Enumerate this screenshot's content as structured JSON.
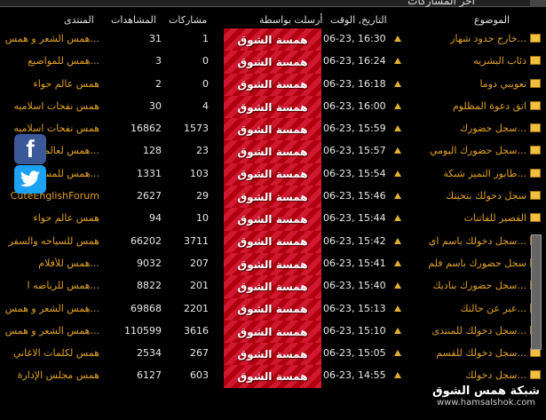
{
  "window": {
    "title": "آخر المشاركات"
  },
  "headers": {
    "topic": "الموضوع",
    "date": "التاريخ, الوقت",
    "user": "أرسلت بواسطة",
    "posts": "مشاركات",
    "views": "المشاهدات",
    "forum": "المنتدى"
  },
  "rows": [
    {
      "topic": "خارج حدود شهار...",
      "date": "06-23, 16:30",
      "user": "همسة الشوق",
      "posts": "1",
      "views": "31",
      "forum": "همس الشعر و همس..."
    },
    {
      "topic": "ذئاب البشريه",
      "date": "06-23, 16:24",
      "user": "همسة الشوق",
      "posts": "0",
      "views": "3",
      "forum": "همس للمواضيع..."
    },
    {
      "topic": "تعويبي دوما",
      "date": "06-23, 16:18",
      "user": "همسة الشوق",
      "posts": "0",
      "views": "2",
      "forum": "همس عالم حواء"
    },
    {
      "topic": "اتق دعوة المظلوم",
      "date": "06-23, 16:00",
      "user": "همسة الشوق",
      "posts": "4",
      "views": "30",
      "forum": "همس نفحات اسلاميه"
    },
    {
      "topic": "سجل حضورك...",
      "date": "06-23, 15:59",
      "user": "همسة الشوق",
      "posts": "1573",
      "views": "16862",
      "forum": "همس نفحات اسلاميه"
    },
    {
      "topic": "سجل حضورك اليومي...",
      "date": "06-23, 15:57",
      "user": "همسة الشوق",
      "posts": "23",
      "views": "128",
      "forum": "همس لعالم..."
    },
    {
      "topic": "طابور التميز شبكة...",
      "date": "06-23, 15:54",
      "user": "همسة الشوق",
      "posts": "103",
      "views": "1331",
      "forum": "همس للمس..."
    },
    {
      "topic": "سجل دخولك بتحيتك",
      "date": "06-23, 15:46",
      "user": "همسة الشوق",
      "posts": "29",
      "views": "2627",
      "forum": "CuteEnglishForum"
    },
    {
      "topic": "القصير للفاتنات",
      "date": "06-23, 15:44",
      "user": "همسة الشوق",
      "posts": "10",
      "views": "94",
      "forum": "همس عالم حواء"
    },
    {
      "topic": "سجل دخولك باسم اي...",
      "date": "06-23, 15:42",
      "user": "همسة الشوق",
      "posts": "3711",
      "views": "66202",
      "forum": "همس للسياحه والسفر"
    },
    {
      "topic": "سجل حضورك باسم فلم",
      "date": "06-23, 15:41",
      "user": "همسة الشوق",
      "posts": "207",
      "views": "9032",
      "forum": "همس للأفلام..."
    },
    {
      "topic": "سجل حضورك بناديك...",
      "date": "06-23, 15:40",
      "user": "همسة الشوق",
      "posts": "201",
      "views": "8822",
      "forum": "همس للرياضه ا..."
    },
    {
      "topic": "عبر عن حالتك...",
      "date": "06-23, 15:13",
      "user": "همسة الشوق",
      "posts": "2201",
      "views": "69868",
      "forum": "همس الشعر و همس..."
    },
    {
      "topic": "سجل دخولك للمنتدى...",
      "date": "06-23, 15:10",
      "user": "همسة الشوق",
      "posts": "3616",
      "views": "110599",
      "forum": "همس الشعر و همس..."
    },
    {
      "topic": "سجل دخولك للقسم...",
      "date": "06-23, 15:05",
      "user": "همسة الشوق",
      "posts": "267",
      "views": "2534",
      "forum": "همس لكلمات الاغاني"
    },
    {
      "topic": "سجل دخولك...",
      "date": "06-23, 14:55",
      "user": "همسة الشوق",
      "posts": "603",
      "views": "6127",
      "forum": "همس مجلس الإدارة"
    }
  ],
  "social": {
    "facebook_icon": "facebook-icon",
    "twitter_icon": "twitter-icon",
    "facebook_glyph": "f"
  },
  "brand": {
    "name": "شبكة همس الشوق",
    "url": "www.hamsalshok.com"
  },
  "colors": {
    "accent": "#e0a020",
    "user_bg": "#c01020",
    "facebook": "#3b5998",
    "twitter": "#1da1f2"
  }
}
